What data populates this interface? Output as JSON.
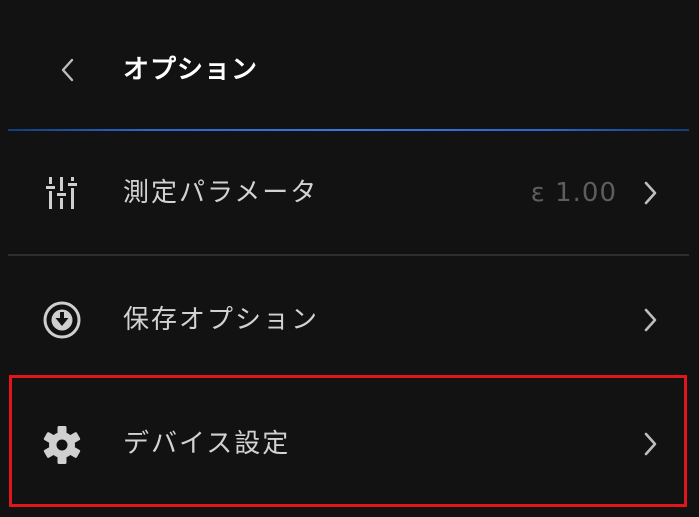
{
  "header": {
    "title": "オプション",
    "back_icon": "chevron-left-icon",
    "accent_color": "#2b66c9"
  },
  "menu": {
    "items": [
      {
        "label": "測定パラメータ",
        "icon": "sliders-icon",
        "value": "ε 1.00",
        "chevron": "chevron-right-icon"
      },
      {
        "label": "保存オプション",
        "icon": "download-circle-icon",
        "value": "",
        "chevron": "chevron-right-icon"
      },
      {
        "label": "デバイス設定",
        "icon": "gear-icon",
        "value": "",
        "chevron": "chevron-right-icon",
        "highlighted": true,
        "highlight_color": "#e0161a"
      }
    ]
  }
}
